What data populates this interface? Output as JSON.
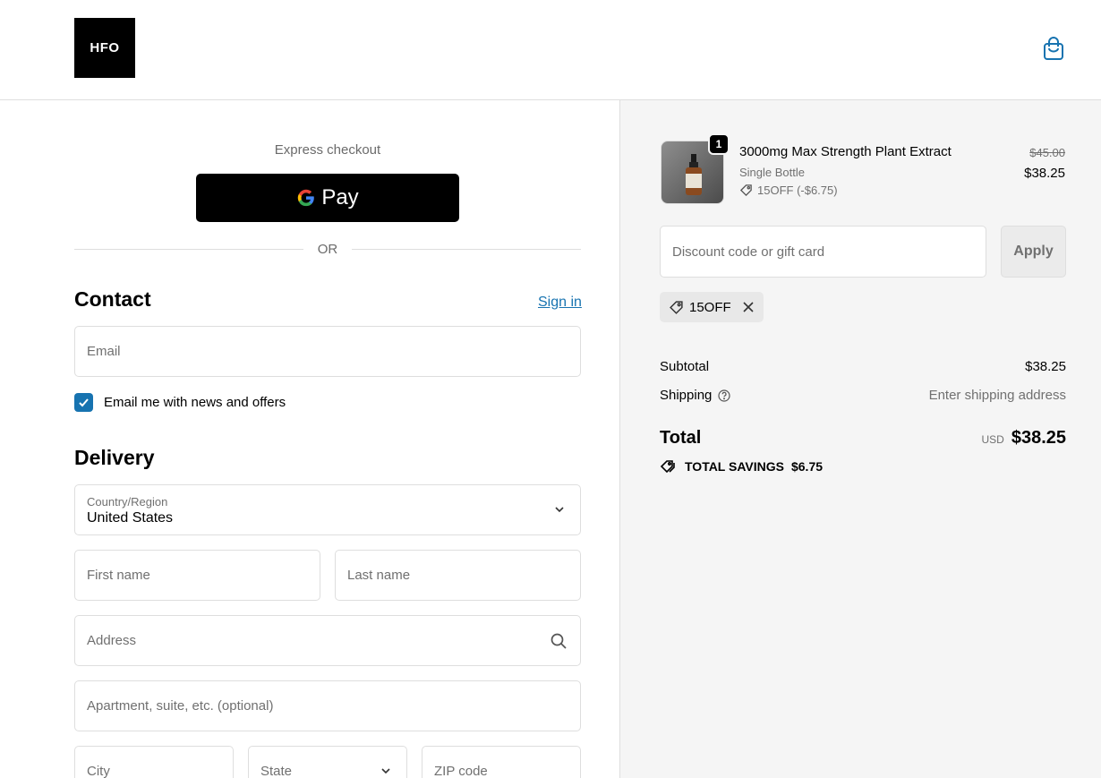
{
  "header": {
    "logo_text": "HFO",
    "cart_icon": "shopping-bag-icon"
  },
  "express": {
    "label": "Express checkout",
    "gpay_label": "Pay",
    "or_text": "OR"
  },
  "contact": {
    "title": "Contact",
    "sign_in": "Sign in",
    "email_placeholder": "Email",
    "newsletter_label": "Email me with news and offers",
    "newsletter_checked": true
  },
  "delivery": {
    "title": "Delivery",
    "country_label": "Country/Region",
    "country_value": "United States",
    "first_name_placeholder": "First name",
    "last_name_placeholder": "Last name",
    "address_placeholder": "Address",
    "apartment_placeholder": "Apartment, suite, etc. (optional)",
    "city_placeholder": "City",
    "state_placeholder": "State",
    "zip_placeholder": "ZIP code"
  },
  "order": {
    "product": {
      "name": "3000mg Max Strength Plant Extract",
      "variant": "Single Bottle",
      "discount": "15OFF (-$6.75)",
      "quantity": "1",
      "price_original": "$45.00",
      "price_final": "$38.25"
    },
    "discount_placeholder": "Discount code or gift card",
    "apply_label": "Apply",
    "applied_code": "15OFF",
    "subtotal_label": "Subtotal",
    "subtotal_value": "$38.25",
    "shipping_label": "Shipping",
    "shipping_value": "Enter shipping address",
    "total_label": "Total",
    "currency": "USD",
    "total_value": "$38.25",
    "savings_label": "TOTAL SAVINGS",
    "savings_value": "$6.75"
  },
  "colors": {
    "accent": "#1773b0",
    "summary_bg": "#f5f5f5",
    "border": "#dedede"
  }
}
